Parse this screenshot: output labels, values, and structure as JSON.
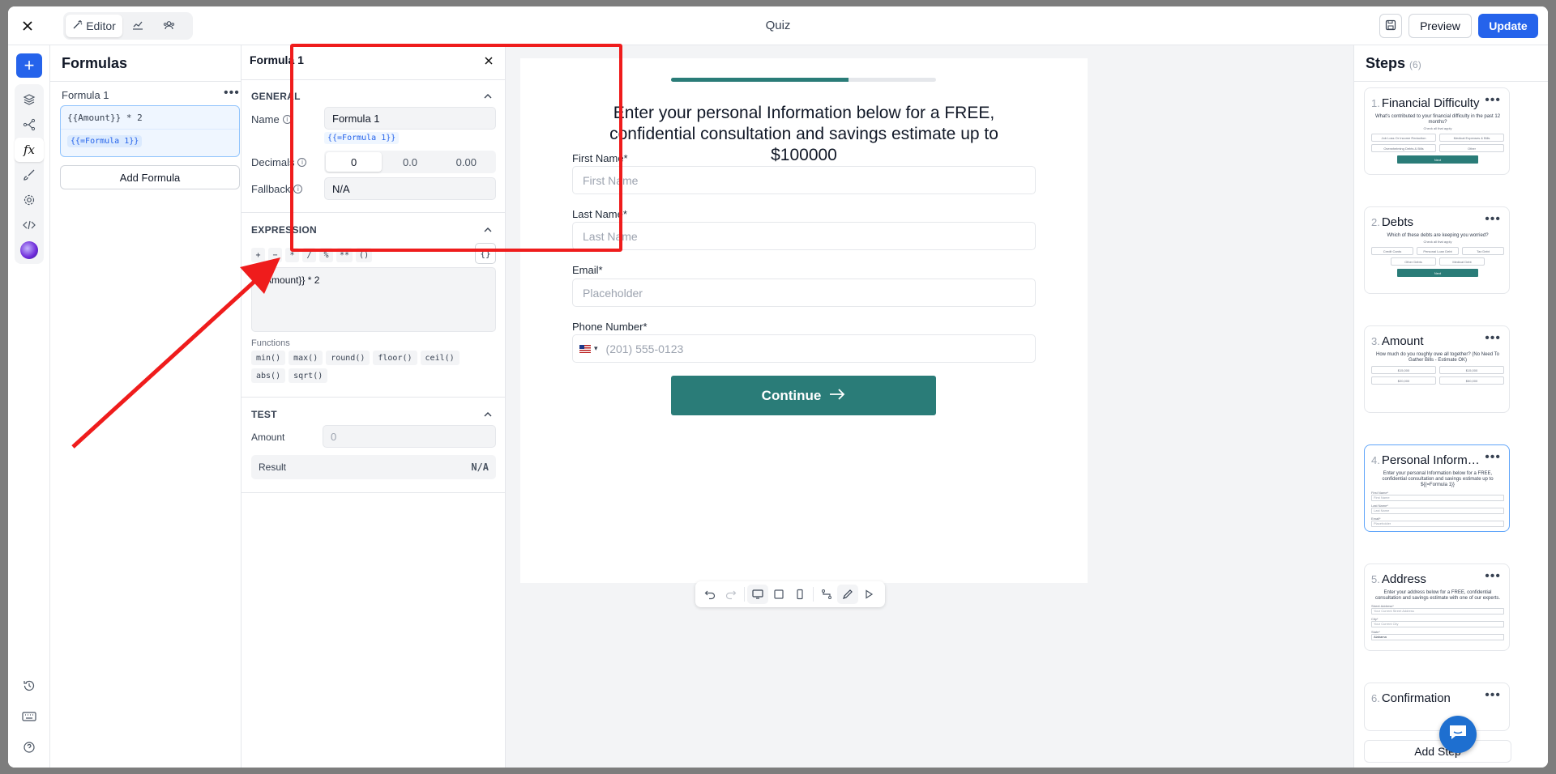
{
  "topbar": {
    "tabs": [
      {
        "label": "Editor",
        "icon": "wand-icon"
      },
      {
        "icon": "chart-icon"
      },
      {
        "icon": "users-icon"
      }
    ],
    "title": "Quiz",
    "preview_label": "Preview",
    "update_label": "Update"
  },
  "rail": {
    "icons": [
      "layers-icon",
      "branch-icon",
      "function-icon",
      "brush-icon",
      "settings-icon",
      "code-icon",
      "ai-icon",
      "history-icon",
      "keyboard-icon",
      "help-icon"
    ]
  },
  "formulas": {
    "title": "Formulas",
    "items": [
      {
        "name": "Formula 1",
        "expression": "{{Amount}} * 2",
        "token": "{{=Formula 1}}"
      }
    ],
    "add_label": "Add Formula"
  },
  "editor": {
    "title": "Formula 1",
    "general": {
      "heading": "GENERAL",
      "name_label": "Name",
      "name_value": "Formula 1",
      "reference": "{{=Formula 1}}",
      "decimals_label": "Decimals",
      "decimals_options": [
        "0",
        "0.0",
        "0.00"
      ],
      "decimals_selected": "0",
      "fallback_label": "Fallback",
      "fallback_value": "N/A"
    },
    "expression": {
      "heading": "EXPRESSION",
      "operators": [
        "+",
        "−",
        "*",
        "/",
        "%",
        "**",
        "()"
      ],
      "braces": "{}",
      "value": "{{Amount}} * 2",
      "functions_label": "Functions",
      "functions": [
        "min()",
        "max()",
        "round()",
        "floor()",
        "ceil()",
        "abs()",
        "sqrt()"
      ]
    },
    "test": {
      "heading": "TEST",
      "amount_label": "Amount",
      "amount_placeholder": "0",
      "result_label": "Result",
      "result_value": "N/A"
    }
  },
  "preview": {
    "progress": 0.67,
    "headline": "Enter your personal Information below for a FREE, confidential consultation and savings estimate up to $100000",
    "fields": [
      {
        "label": "First Name*",
        "placeholder": "First Name"
      },
      {
        "label": "Last Name*",
        "placeholder": "Last Name"
      },
      {
        "label": "Email*",
        "placeholder": "Placeholder"
      },
      {
        "label": "Phone Number*",
        "placeholder": "(201) 555-0123",
        "country": "▾"
      }
    ],
    "continue_label": "Continue",
    "progress_color": "#2a7c78"
  },
  "steps": {
    "title": "Steps",
    "count": "(6)",
    "items": [
      {
        "num": "1.",
        "name": "Financial Difficulty",
        "q": "What's contributed to your financial difficulty in the past 12 months?",
        "sub": "Check all that apply",
        "opts": [
          "Job Loss Or Income Reduction",
          "Medical Expenses & Bills",
          "Overwhelming Debts & Bills",
          "Other"
        ],
        "btn": "Next"
      },
      {
        "num": "2.",
        "name": "Debts",
        "q": "Which of these debts are keeping you worried?",
        "sub": "Check all that apply",
        "opts": [
          "Credit Cards",
          "Personal Loan Debt",
          "Tax Debt",
          "Other Debts",
          "Medical Debt"
        ],
        "btn": "Next"
      },
      {
        "num": "3.",
        "name": "Amount",
        "q": "How much do you roughly owe all together? (No Need To Gather Bills - Estimate OK)",
        "opts": [
          "$15,000",
          "$15,000",
          "$20,000",
          "$50,000"
        ]
      },
      {
        "num": "4.",
        "name": "Personal Information",
        "q": "Enter your personal Information below for a FREE, confidential consultation and savings estimate up to ${{=Formula 1}}",
        "fields": [
          "First Name*",
          "Last Name*",
          "Email*"
        ],
        "placeholders": [
          "First Name",
          "Last Name",
          "Placeholder"
        ]
      },
      {
        "num": "5.",
        "name": "Address",
        "q": "Enter your address below for a FREE, confidential consultation and savings estimate with one of our experts.",
        "fields": [
          "Street Address*",
          "City*",
          "State*"
        ],
        "placeholders": [
          "Your Current Street Address",
          "Your Current City",
          "Alabama"
        ]
      },
      {
        "num": "6.",
        "name": "Confirmation"
      }
    ],
    "add_label": "Add Step"
  }
}
